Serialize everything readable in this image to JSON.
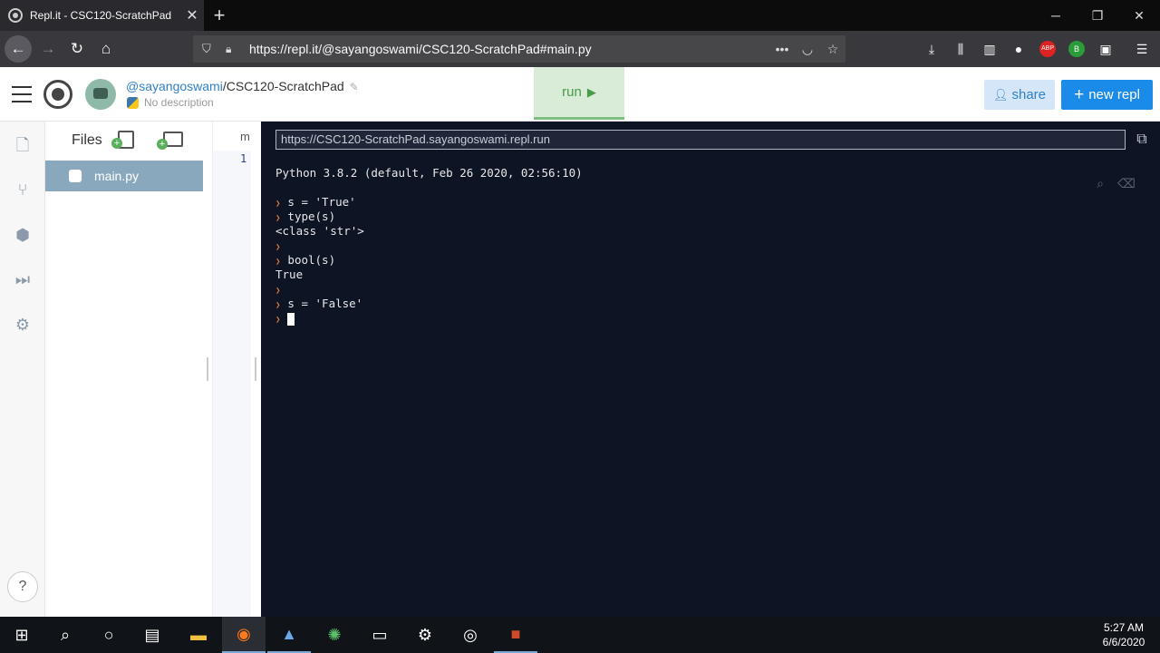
{
  "browser": {
    "tab_title": "Repl.it - CSC120-ScratchPad",
    "tab_close": "✕",
    "new_tab": "+",
    "url": "https://repl.it/@sayangoswami/CSC120-ScratchPad#main.py",
    "window_controls": [
      "─",
      "❐",
      "✕"
    ]
  },
  "header": {
    "username": "@sayangoswami",
    "project": "/CSC120-ScratchPad",
    "description": "No description",
    "run_label": "run",
    "run_icon": "▶",
    "share_label": "share",
    "new_repl_label": "new repl"
  },
  "files": {
    "heading": "Files",
    "items": [
      {
        "name": "main.py"
      }
    ]
  },
  "editor": {
    "tab_label": "m",
    "line_numbers": [
      "1"
    ]
  },
  "console": {
    "run_url": "https://CSC120-ScratchPad.sayangoswami.repl.run",
    "banner": "Python 3.8.2 (default, Feb 26 2020, 02:56:10)",
    "lines": [
      {
        "type": "input",
        "text": "s = 'True'"
      },
      {
        "type": "input",
        "text": "type(s)"
      },
      {
        "type": "output",
        "text": "<class 'str'>"
      },
      {
        "type": "input",
        "text": ""
      },
      {
        "type": "input",
        "text": "bool(s)"
      },
      {
        "type": "output",
        "text": "True"
      },
      {
        "type": "input",
        "text": ""
      },
      {
        "type": "input",
        "text": "s = 'False'"
      }
    ]
  },
  "taskbar": {
    "time": "5:27 AM",
    "date": "6/6/2020"
  },
  "colors": {
    "console_bg": "#0d1424",
    "prompt": "#e07a3a",
    "accent_blue": "#1a8be8",
    "run_green": "#4a9a4a"
  }
}
